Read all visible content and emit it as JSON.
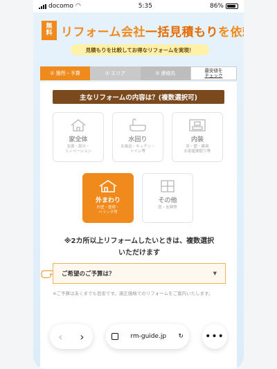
{
  "status_bar": {
    "carrier": "docomo",
    "time": "5:35",
    "battery": "86%"
  },
  "header": {
    "free_badge_top": "無",
    "free_badge_bottom": "料",
    "title_pre": "リフォーム会社",
    "title_accent": "一括見積もり",
    "title_post": "を依頼",
    "subtitle": "見積もりを比較してお得なリフォームを実現！"
  },
  "steps": [
    {
      "label": "① 箇所・予算"
    },
    {
      "label": "② エリア"
    },
    {
      "label": "③ 連絡先"
    },
    {
      "label_top": "最安値を",
      "label_bottom": "チェック"
    }
  ],
  "question": {
    "title": "主なリフォームの内容は？(複数選択可)"
  },
  "options": [
    {
      "name": "家全体",
      "desc": "全面・部分・\nリノベーション",
      "icon": "house-icon",
      "selected": false
    },
    {
      "name": "水回り",
      "desc": "お風呂・キッチン・\nトイレ等",
      "icon": "bathtub-icon",
      "selected": false
    },
    {
      "name": "内装",
      "desc": "床・壁・建具\nお部屋間取り等",
      "icon": "interior-icon",
      "selected": false
    },
    {
      "name": "外まわり",
      "desc": "外壁・屋根・\nベランダ等",
      "icon": "exterior-roof-icon",
      "selected": true
    },
    {
      "name": "その他",
      "desc": "窓・玄関等",
      "icon": "window-icon",
      "selected": false
    }
  ],
  "note": {
    "line1": "※2カ所以上リフォームしたいときは、複数選択",
    "line2": "いただけます"
  },
  "budget": {
    "placeholder": "ご希望のご予算は？"
  },
  "fine_print": "※ご予算はあくまでも目安です。適正価格でのリフォームをご案内いたします。",
  "browser": {
    "url": "rm-guide.jp"
  },
  "colors": {
    "accent": "#f08a1c",
    "brown": "#7a4a1e"
  }
}
